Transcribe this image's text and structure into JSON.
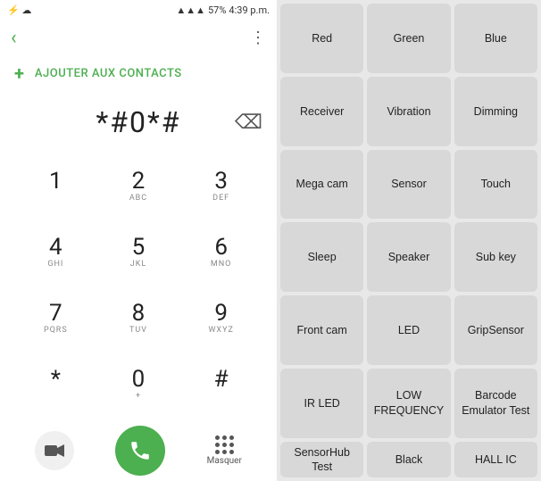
{
  "status": {
    "left_icons": "⚡☁",
    "signal": "📶",
    "battery": "57%",
    "time": "4:39 p.m."
  },
  "top_bar": {
    "back_label": "‹",
    "more_label": "⋮"
  },
  "add_contact": {
    "plus": "+",
    "label": "AJOUTER AUX CONTACTS"
  },
  "dialer": {
    "number": "*#0*#",
    "backspace": "⌫"
  },
  "keys": [
    {
      "main": "1",
      "sub": ""
    },
    {
      "main": "2",
      "sub": "ABC"
    },
    {
      "main": "3",
      "sub": "DEF"
    },
    {
      "main": "4",
      "sub": "GHI"
    },
    {
      "main": "5",
      "sub": "JKL"
    },
    {
      "main": "6",
      "sub": "MNO"
    },
    {
      "main": "7",
      "sub": "PQRS"
    },
    {
      "main": "8",
      "sub": "TUV"
    },
    {
      "main": "9",
      "sub": "WXYZ"
    },
    {
      "main": "*",
      "sub": ""
    },
    {
      "main": "0",
      "sub": "+"
    },
    {
      "main": "#",
      "sub": ""
    }
  ],
  "bottom_bar": {
    "masquer_label": "Masquer"
  },
  "test_buttons": [
    "Red",
    "Green",
    "Blue",
    "Receiver",
    "Vibration",
    "Dimming",
    "Mega cam",
    "Sensor",
    "Touch",
    "Sleep",
    "Speaker",
    "Sub key",
    "Front cam",
    "LED",
    "GripSensor",
    "IR LED",
    "LOW\nFREQUENCY",
    "Barcode\nEmulator\nTest",
    "SensorHub\nTest",
    "Black",
    "HALL IC"
  ]
}
